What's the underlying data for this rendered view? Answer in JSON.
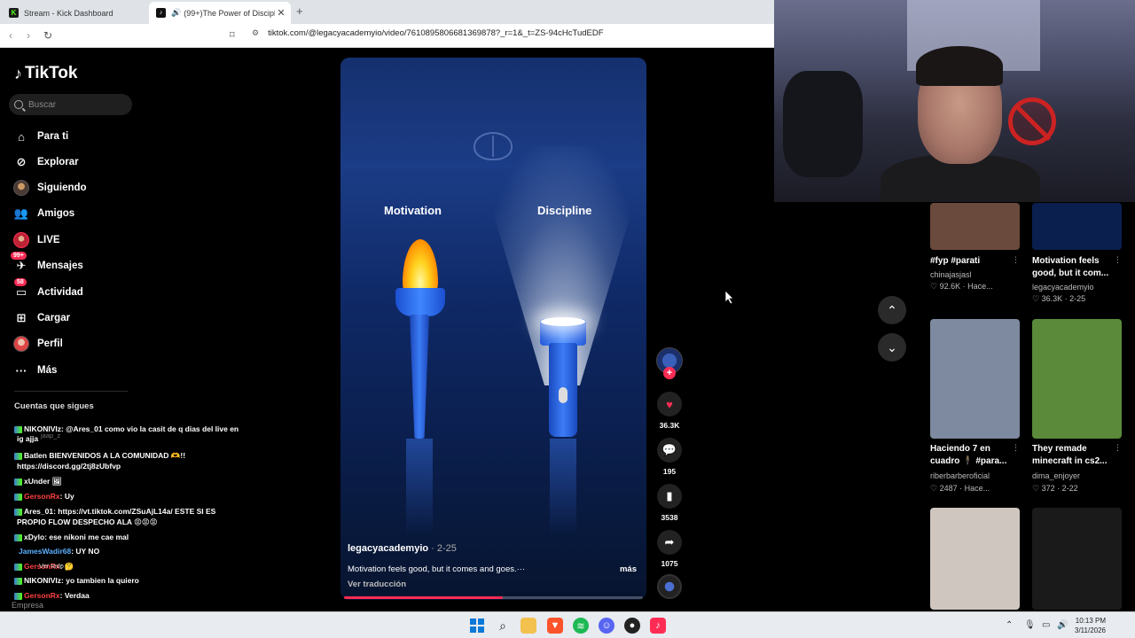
{
  "browser": {
    "tabs": [
      {
        "title": "Stream - Kick Dashboard",
        "favicon": "kick-icon",
        "active": false
      },
      {
        "title": "(99+)The Power of Discipline",
        "favicon": "tiktok-icon",
        "active": true
      }
    ],
    "url": "tiktok.com/@legacyacademyio/video/7610895806681369878?_r=1&_t=ZS-94cHcTudEDF"
  },
  "sidebar": {
    "logo": "TikTok",
    "search_placeholder": "Buscar",
    "items": [
      {
        "label": "Para ti",
        "icon": "home-icon"
      },
      {
        "label": "Explorar",
        "icon": "compass-icon"
      },
      {
        "label": "Siguiendo",
        "icon": "following-avatar-icon"
      },
      {
        "label": "Amigos",
        "icon": "friends-icon"
      },
      {
        "label": "LIVE",
        "icon": "live-avatar-icon"
      },
      {
        "label": "Mensajes",
        "icon": "messages-icon",
        "badge": "99+"
      },
      {
        "label": "Actividad",
        "icon": "activity-icon",
        "badge": "58"
      },
      {
        "label": "Cargar",
        "icon": "upload-icon"
      },
      {
        "label": "Perfil",
        "icon": "profile-avatar-icon"
      },
      {
        "label": "Más",
        "icon": "more-icon"
      }
    ],
    "following_title": "Cuentas que sigues",
    "footer": "Empresa"
  },
  "chat": [
    {
      "user": "NIKONIVIz",
      "text": ": @Ares_01 como vio la casit de q dias del live en",
      "cont": "ig ajja",
      "color": "white"
    },
    {
      "user": "Batlen",
      "text": "BIENVENIDOS A LA COMUNIDAD 🫶!!",
      "cont": "https://discord.gg/2tj8zUbfvp",
      "color": "white"
    },
    {
      "user": "xUnder",
      "text": "",
      "color": "white"
    },
    {
      "user": "GersonRx",
      "text": ": Uy",
      "color": "red"
    },
    {
      "user": "Ares_01",
      "text": ": https://vt.tiktok.com/ZSuAjL14a/ ESTE SI ES",
      "cont": "PROPIO FLOW DESPECHO ALA 😡😡😡",
      "color": "white"
    },
    {
      "user": "xDylo",
      "text": ": ese nikoni me cae mal",
      "color": "white"
    },
    {
      "user": "JamesWadir68",
      "text": ": UY NO",
      "color": "blue"
    },
    {
      "user": "GersonRx",
      "text": ": 🤔",
      "color": "red"
    },
    {
      "user": "NIKONIVIz",
      "text": ": yo tambien la quiero",
      "color": "white"
    },
    {
      "user": "GersonRx",
      "text": ": Verdaa",
      "color": "red"
    }
  ],
  "chat_ghost": [
    "jaap_z",
    "Ver todo"
  ],
  "video": {
    "label_left": "Motivation",
    "label_right": "Discipline",
    "author": "legacyacademyio",
    "date": "2-25",
    "caption": "Motivation feels good, but it comes and goes.···",
    "more": "más",
    "translate": "Ver traducción",
    "progress": 0.53
  },
  "actions": {
    "likes": "36.3K",
    "comments": "195",
    "saves": "3538",
    "shares": "1075"
  },
  "recommendations": [
    {
      "title": "#fyp #parati",
      "author": "chinajasjasl",
      "stats": "♡ 92.6K · Hace...",
      "thumb_color": "#6a4a3c"
    },
    {
      "title": "Motivation feels good, but it com...",
      "author": "legacyacademyio",
      "stats": "♡ 36.3K · 2-25",
      "thumb_color": "#0b1f4e"
    },
    {
      "title": "Haciendo 7 en cuadro 🕴 #para...",
      "author": "riberbarberoficial",
      "stats": "♡ 2487 · Hace...",
      "thumb_color": "#7d8aa0"
    },
    {
      "title": "They remade minecraft in cs2...",
      "author": "dima_enjoyer",
      "stats": "♡ 372 · 2-22",
      "thumb_color": "#5a8a3a"
    },
    {
      "title": "",
      "author": "",
      "stats": "",
      "thumb_color": "#cfc6c0"
    },
    {
      "title": "",
      "author": "",
      "stats": "",
      "thumb_color": "#1a1a1a"
    }
  ],
  "taskbar": {
    "time": "10:13 PM",
    "date": "3/11/2026"
  },
  "colors": {
    "tiktok_red": "#fe2c55",
    "bg": "#000000"
  }
}
